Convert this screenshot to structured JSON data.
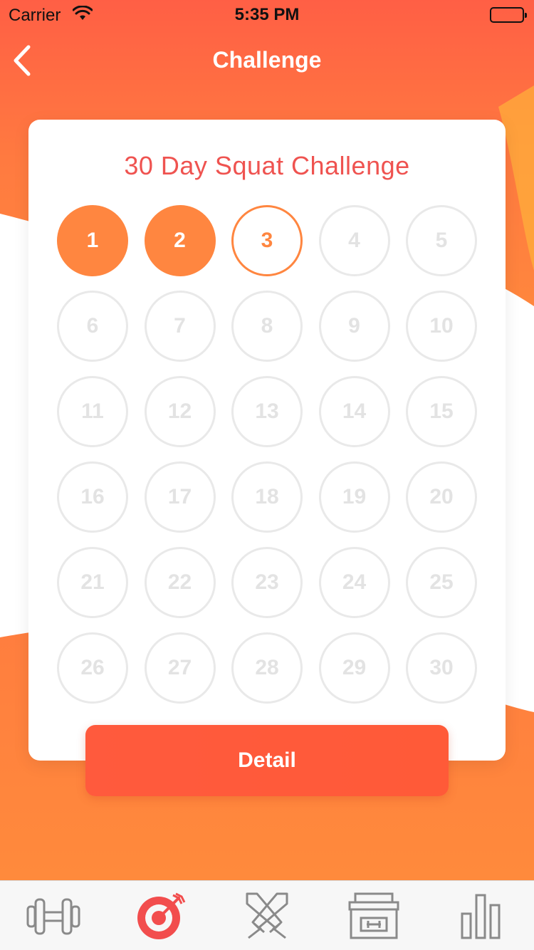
{
  "status_bar": {
    "carrier": "Carrier",
    "time": "5:35 PM"
  },
  "nav": {
    "title": "Challenge"
  },
  "challenge": {
    "title": "30 Day Squat Challenge",
    "days": [
      {
        "label": "1",
        "state": "done"
      },
      {
        "label": "2",
        "state": "done"
      },
      {
        "label": "3",
        "state": "current"
      },
      {
        "label": "4",
        "state": "locked"
      },
      {
        "label": "5",
        "state": "locked"
      },
      {
        "label": "6",
        "state": "locked"
      },
      {
        "label": "7",
        "state": "locked"
      },
      {
        "label": "8",
        "state": "locked"
      },
      {
        "label": "9",
        "state": "locked"
      },
      {
        "label": "10",
        "state": "locked"
      },
      {
        "label": "11",
        "state": "locked"
      },
      {
        "label": "12",
        "state": "locked"
      },
      {
        "label": "13",
        "state": "locked"
      },
      {
        "label": "14",
        "state": "locked"
      },
      {
        "label": "15",
        "state": "locked"
      },
      {
        "label": "16",
        "state": "locked"
      },
      {
        "label": "17",
        "state": "locked"
      },
      {
        "label": "18",
        "state": "locked"
      },
      {
        "label": "19",
        "state": "locked"
      },
      {
        "label": "20",
        "state": "locked"
      },
      {
        "label": "21",
        "state": "locked"
      },
      {
        "label": "22",
        "state": "locked"
      },
      {
        "label": "23",
        "state": "locked"
      },
      {
        "label": "24",
        "state": "locked"
      },
      {
        "label": "25",
        "state": "locked"
      },
      {
        "label": "26",
        "state": "locked"
      },
      {
        "label": "27",
        "state": "locked"
      },
      {
        "label": "28",
        "state": "locked"
      },
      {
        "label": "29",
        "state": "locked"
      },
      {
        "label": "30",
        "state": "locked"
      }
    ],
    "detail_label": "Detail"
  },
  "tabbar": {
    "tabs": [
      {
        "icon": "dumbbell-icon",
        "active": false
      },
      {
        "icon": "target-icon",
        "active": true
      },
      {
        "icon": "crossed-swords-icon",
        "active": false
      },
      {
        "icon": "gym-store-icon",
        "active": false
      },
      {
        "icon": "bar-chart-icon",
        "active": false
      }
    ]
  },
  "colors": {
    "accent": "#ff8640",
    "title": "#ef5350",
    "button": "#ff5a3d",
    "active_tab": "#f24d4d",
    "inactive_tab": "#8a8a8a"
  }
}
